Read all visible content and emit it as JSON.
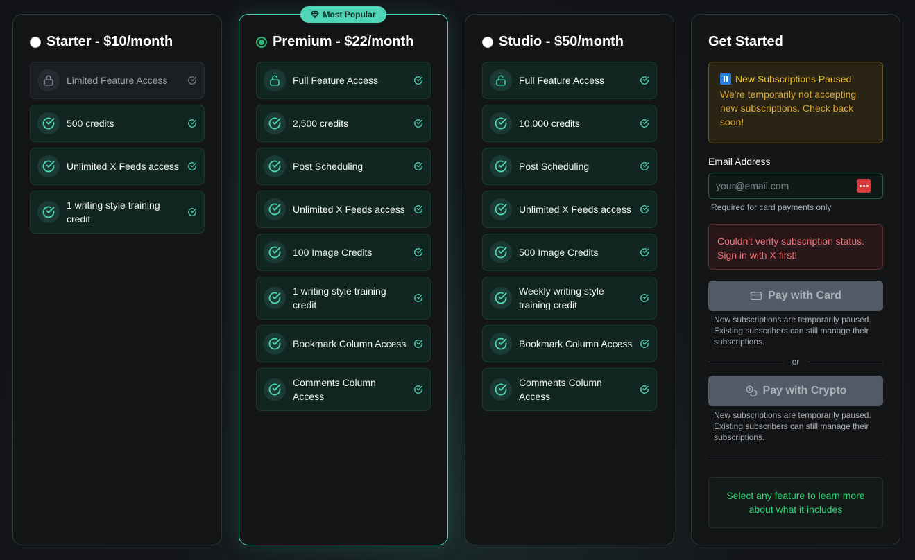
{
  "plans": [
    {
      "title": "Starter - $10/month",
      "features": [
        {
          "label": "Limited Feature Access",
          "icon": "lock-icon"
        },
        {
          "label": "500 credits",
          "icon": "check-circle-icon"
        },
        {
          "label": "Unlimited X Feeds access",
          "icon": "check-circle-icon"
        },
        {
          "label": "1 writing style training credit",
          "icon": "check-circle-icon"
        }
      ]
    },
    {
      "title": "Premium - $22/month",
      "badge": "Most Popular",
      "features": [
        {
          "label": "Full Feature Access",
          "icon": "unlock-icon"
        },
        {
          "label": "2,500 credits",
          "icon": "check-circle-icon"
        },
        {
          "label": "Post Scheduling",
          "icon": "check-circle-icon"
        },
        {
          "label": "Unlimited X Feeds access",
          "icon": "check-circle-icon"
        },
        {
          "label": "100 Image Credits",
          "icon": "check-circle-icon"
        },
        {
          "label": "1 writing style training credit",
          "icon": "check-circle-icon"
        },
        {
          "label": "Bookmark Column Access",
          "icon": "check-circle-icon"
        },
        {
          "label": "Comments Column Access",
          "icon": "check-circle-icon"
        }
      ]
    },
    {
      "title": "Studio - $50/month",
      "features": [
        {
          "label": "Full Feature Access",
          "icon": "unlock-icon"
        },
        {
          "label": "10,000 credits",
          "icon": "check-circle-icon"
        },
        {
          "label": "Post Scheduling",
          "icon": "check-circle-icon"
        },
        {
          "label": "Unlimited X Feeds access",
          "icon": "check-circle-icon"
        },
        {
          "label": "500 Image Credits",
          "icon": "check-circle-icon"
        },
        {
          "label": "Weekly writing style training credit",
          "icon": "check-circle-icon"
        },
        {
          "label": "Bookmark Column Access",
          "icon": "check-circle-icon"
        },
        {
          "label": "Comments Column Access",
          "icon": "check-circle-icon"
        }
      ]
    }
  ],
  "get_started": {
    "title": "Get Started",
    "notice_title": "New Subscriptions Paused",
    "notice_body": "We're temporarily not accepting new subscriptions. Check back soon!",
    "email_label": "Email Address",
    "email_placeholder": "your@email.com",
    "email_hint": "Required for card payments only",
    "error": "Couldn't verify subscription status. Sign in with X first!",
    "pay_card": "Pay with Card",
    "pay_card_note": "New subscriptions are temporarily paused. Existing subscribers can still manage their subscriptions.",
    "or": "or",
    "pay_crypto": "Pay with Crypto",
    "pay_crypto_note": "New subscriptions are temporarily paused. Existing subscribers can still manage their subscriptions.",
    "select_hint": "Select any feature to learn more about what it includes"
  },
  "colors": {
    "accent": "#4fd6b8",
    "selected_radio": "#2fb476",
    "warning": "#f2c419",
    "error": "#f07178",
    "hint_green": "#2fd475"
  }
}
